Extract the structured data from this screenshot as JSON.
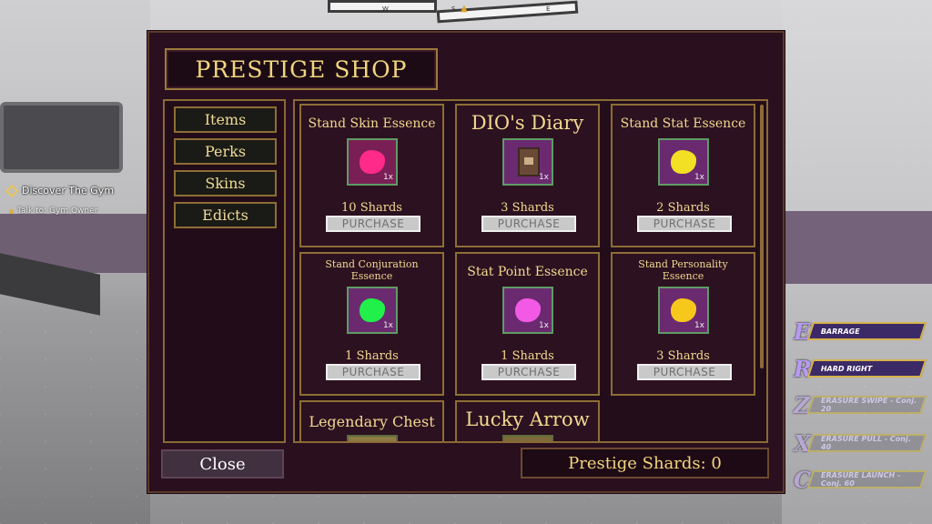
{
  "compass": {
    "labels": [
      "W",
      "S",
      "E"
    ],
    "marker": "▲"
  },
  "quest": {
    "title": "Discover The Gym",
    "objective": "Talk to: Gym Owner"
  },
  "shop": {
    "title": "PRESTIGE SHOP",
    "nav": [
      "Items",
      "Perks",
      "Skins",
      "Edicts"
    ],
    "items": [
      {
        "name": "Stand Skin Essence",
        "qty": "1x",
        "price": "10 Shards",
        "buy": "PURCHASE"
      },
      {
        "name": "DIO's Diary",
        "qty": "1x",
        "price": "3 Shards",
        "buy": "PURCHASE"
      },
      {
        "name": "Stand Stat Essence",
        "qty": "1x",
        "price": "2 Shards",
        "buy": "PURCHASE"
      },
      {
        "name": "Stand Conjuration Essence",
        "qty": "1x",
        "price": "1 Shards",
        "buy": "PURCHASE"
      },
      {
        "name": "Stat Point Essence",
        "qty": "1x",
        "price": "1 Shards",
        "buy": "PURCHASE"
      },
      {
        "name": "Stand Personality Essence",
        "qty": "1x",
        "price": "3 Shards",
        "buy": "PURCHASE"
      },
      {
        "name": "Legendary Chest"
      },
      {
        "name": "Lucky Arrow"
      }
    ],
    "close_label": "Close",
    "shards_label": "Prestige Shards: 0"
  },
  "abilities": [
    {
      "key": "E",
      "label": "BARRAGE"
    },
    {
      "key": "R",
      "label": "HARD RIGHT"
    },
    {
      "key": "Z",
      "label": "ERASURE SWIPE - Conj. 20"
    },
    {
      "key": "X",
      "label": "ERASURE PULL - Conj. 40"
    },
    {
      "key": "C",
      "label": "ERASURE LAUNCH - Conj. 60"
    }
  ],
  "colors": {
    "essence_red": "#ff2a8a",
    "essence_yellow": "#f2e024",
    "essence_green": "#22f04a",
    "essence_pink": "#f25ae6",
    "essence_gold": "#f7c81c",
    "accent_gold": "#f1d57e"
  }
}
